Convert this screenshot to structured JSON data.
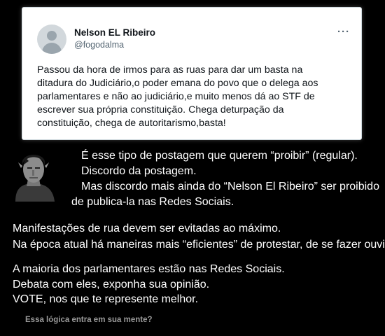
{
  "tweet": {
    "author_name": "Nelson EL Ribeiro",
    "handle": "@fogodalma",
    "more_label": "···",
    "text": "Passou da hora de irmos para as ruas para dar um basta na\nditadura do Judiciário,o poder emana do povo que o delega aos\nparlamentares e não ao judiciário,e muito menos dá ao STF de\nescrever sua própria constituição. Chega deturpação da\nconstituição, chega de autoritarismo,basta!"
  },
  "commentary": {
    "lines": [
      "É esse tipo de postagem que querem “proibir” (regular).",
      "Discordo da postagem.",
      "Mas discordo mais ainda do “Nelson El Ribeiro” ser proibido",
      "de publica-la nas Redes Sociais.",
      "Manifestações de rua devem ser evitadas ao máximo.",
      "Na época atual há maneiras mais “eficientes” de protestar, de se fazer ouvir.",
      "A maioria dos parlamentares estão nas Redes Sociais.",
      "Debata com eles, exponha sua opinião.",
      "VOTE, nos que te represente melhor."
    ],
    "closing_question": "Essa lógica entra em sua mente?"
  }
}
